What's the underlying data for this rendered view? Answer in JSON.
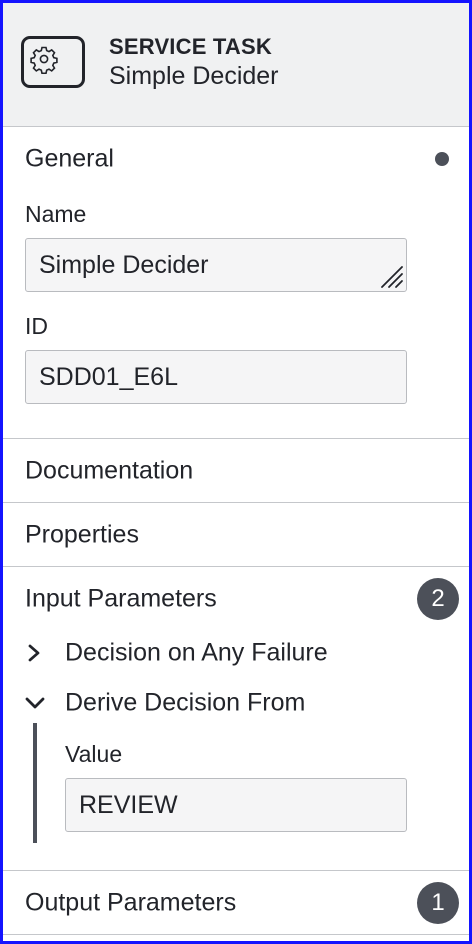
{
  "header": {
    "element_type": "SERVICE TASK",
    "element_name": "Simple Decider",
    "icon": "gear-icon"
  },
  "general": {
    "title": "General",
    "name_label": "Name",
    "name_value": "Simple Decider",
    "id_label": "ID",
    "id_value": "SDD01_E6L"
  },
  "documentation": {
    "title": "Documentation"
  },
  "properties": {
    "title": "Properties"
  },
  "input_parameters": {
    "title": "Input Parameters",
    "count": "2",
    "items": [
      {
        "label": "Decision on Any Failure",
        "expanded": false
      },
      {
        "label": "Derive Decision From",
        "expanded": true,
        "value_label": "Value",
        "value": "REVIEW"
      }
    ]
  },
  "output_parameters": {
    "title": "Output Parameters",
    "count": "1"
  }
}
